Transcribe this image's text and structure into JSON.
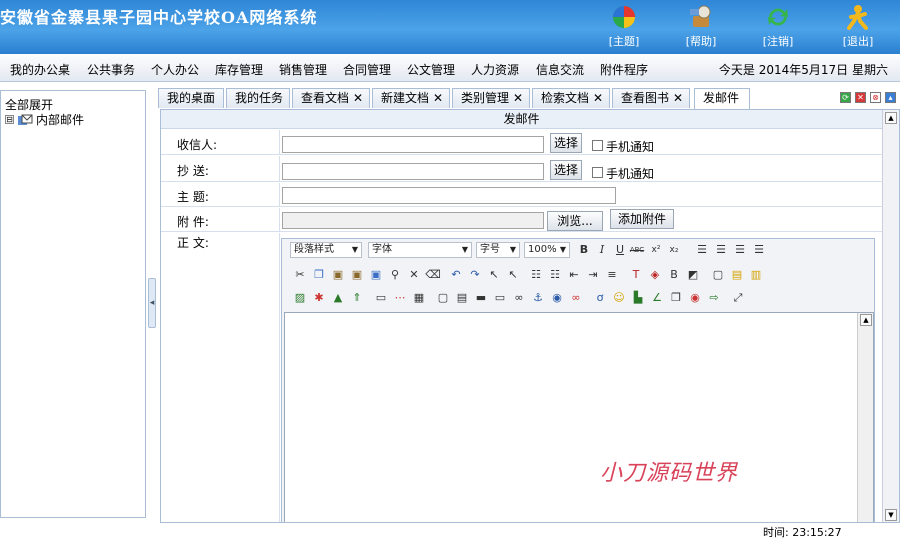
{
  "header": {
    "title": "安徽省金寨县果子园中心学校OA网络系统",
    "buttons": [
      {
        "label": "[主题]",
        "icon": "theme-icon"
      },
      {
        "label": "[帮助]",
        "icon": "help-icon"
      },
      {
        "label": "[注销]",
        "icon": "logout-refresh-icon"
      },
      {
        "label": "[退出]",
        "icon": "exit-icon"
      }
    ]
  },
  "menu": {
    "items": [
      "我的办公桌",
      "公共事务",
      "个人办公",
      "库存管理",
      "销售管理",
      "合同管理",
      "公文管理",
      "人力资源",
      "信息交流",
      "附件程序"
    ],
    "date": "今天是 2014年5月17日 星期六"
  },
  "tree": {
    "root": "全部展开",
    "child": "内部邮件",
    "expander": "⊟"
  },
  "tabs": {
    "items": [
      {
        "label": "我的桌面",
        "closable": false
      },
      {
        "label": "我的任务",
        "closable": false
      },
      {
        "label": "查看文档",
        "closable": true
      },
      {
        "label": "新建文档",
        "closable": true
      },
      {
        "label": "类别管理",
        "closable": true
      },
      {
        "label": "检索文档",
        "closable": true
      },
      {
        "label": "查看图书",
        "closable": true
      },
      {
        "label": "发邮件",
        "closable": false
      }
    ],
    "close_glyph": "✕"
  },
  "form": {
    "title": "发邮件",
    "recipient_label": "收信人:",
    "cc_label": "抄  送:",
    "subject_label": "主  题:",
    "attachment_label": "附  件:",
    "body_label": "正  文:",
    "select_button": "选择",
    "sms_label": "手机通知",
    "browse_button": "浏览...",
    "add_attachment_button": "添加附件",
    "recipient_value": "",
    "cc_value": "",
    "subject_value": ""
  },
  "editor": {
    "style_select": "段落样式",
    "font_select": "字体",
    "size_select": "字号",
    "zoom_select": "100%",
    "format_buttons": [
      "B",
      "I",
      "U",
      "ABC",
      "x²",
      "x₂"
    ]
  },
  "watermark": "小刀源码世界",
  "status": {
    "time": "时间: 23:15:27"
  }
}
